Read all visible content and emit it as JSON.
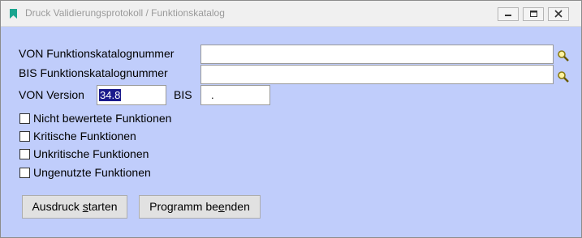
{
  "window": {
    "title": "Druck Validierungsprotokoll / Funktionskatalog"
  },
  "form": {
    "von_katalog_label": "VON Funktionskatalognummer",
    "von_katalog_value": "",
    "bis_katalog_label": "BIS Funktionskatalognummer",
    "bis_katalog_value": "",
    "von_version_label": "VON Version",
    "von_version_value": "34.8",
    "bis_version_label": "BIS",
    "bis_version_value": "."
  },
  "options": [
    {
      "label": "Nicht bewertete Funktionen",
      "checked": false
    },
    {
      "label": "Kritische Funktionen",
      "checked": false
    },
    {
      "label": "Unkritische Funktionen",
      "checked": false
    },
    {
      "label": "Ungenutzte Funktionen",
      "checked": false
    }
  ],
  "buttons": {
    "start": {
      "pre": "Ausdruck ",
      "accel": "s",
      "post": "tarten"
    },
    "end": {
      "pre": "Programm be",
      "accel": "e",
      "post": "nden"
    }
  },
  "icons": {
    "app": "bookmark-icon",
    "minimize": "minimize-icon",
    "maximize": "maximize-icon",
    "close": "close-icon",
    "lookup": "magnifier-icon"
  },
  "colors": {
    "form_background": "#c0cdfb",
    "titlebar": "#f0f0f0",
    "app_icon": "#1aa58f",
    "selection": "#1a1a8c"
  }
}
